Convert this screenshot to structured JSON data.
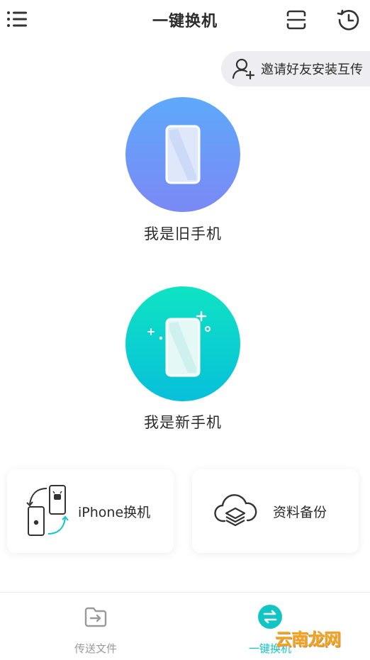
{
  "header": {
    "title": "一键换机",
    "menu_icon": "list-menu-icon",
    "scan_icon": "scan-frame-icon",
    "history_icon": "history-clock-icon"
  },
  "invite": {
    "label": "邀请好友安装互传",
    "icon": "add-user-icon"
  },
  "roles": {
    "old_phone_label": "我是旧手机",
    "new_phone_label": "我是新手机"
  },
  "cards": {
    "iphone_label": "iPhone换机",
    "backup_label": "资料备份"
  },
  "bottom_nav": {
    "files_label": "传送文件",
    "switch_label": "一键换机",
    "active": "switch"
  },
  "watermark": "云南龙网",
  "colors": {
    "accent": "#12c5c5",
    "old_circle_top": "#5ea9fb",
    "old_circle_bottom": "#7a89f5",
    "new_circle_top": "#0fe3c3",
    "new_circle_bottom": "#07bfda"
  }
}
